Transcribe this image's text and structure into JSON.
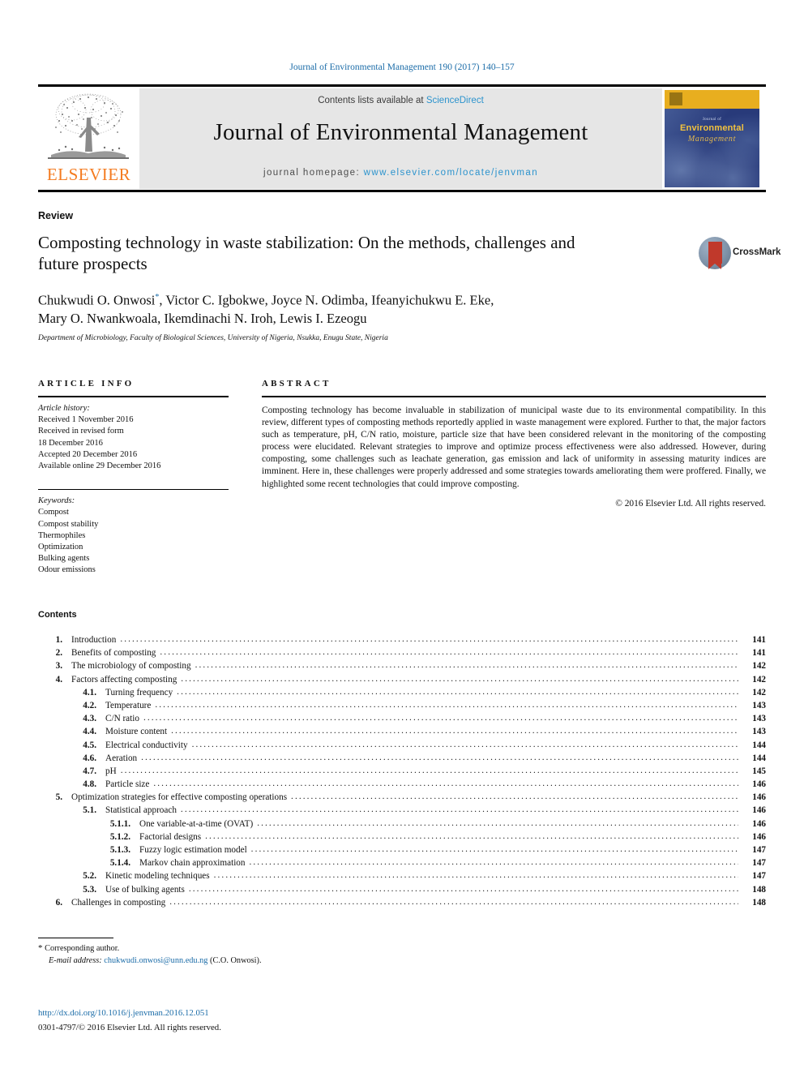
{
  "running_head": "Journal of Environmental Management 190 (2017) 140–157",
  "masthead": {
    "contents_prefix": "Contents lists available at ",
    "contents_link": "ScienceDirect",
    "journal_title": "Journal of Environmental Management",
    "homepage_prefix": "journal homepage: ",
    "homepage_url": "www.elsevier.com/locate/jenvman",
    "publisher_wordmark": "ELSEVIER",
    "cover": {
      "small_line": "Journal of",
      "line1": "Environmental",
      "line2": "Management"
    }
  },
  "article": {
    "type": "Review",
    "title": "Composting technology in waste stabilization: On the methods, challenges and future prospects",
    "authors_line1": "Chukwudi O. Onwosi",
    "authors_marker": "*",
    "authors_line1_rest": ", Victor C. Igbokwe, Joyce N. Odimba, Ifeanyichukwu E. Eke,",
    "authors_line2": "Mary O. Nwankwoala, Ikemdinachi N. Iroh, Lewis I. Ezeogu",
    "affiliation": "Department of Microbiology, Faculty of Biological Sciences, University of Nigeria, Nsukka, Enugu State, Nigeria",
    "crossmark_label": "CrossMark"
  },
  "article_info": {
    "heading": "ARTICLE INFO",
    "history_label": "Article history:",
    "history": [
      "Received 1 November 2016",
      "Received in revised form",
      "18 December 2016",
      "Accepted 20 December 2016",
      "Available online 29 December 2016"
    ],
    "keywords_label": "Keywords:",
    "keywords": [
      "Compost",
      "Compost stability",
      "Thermophiles",
      "Optimization",
      "Bulking agents",
      "Odour emissions"
    ]
  },
  "abstract": {
    "heading": "ABSTRACT",
    "text": "Composting technology has become invaluable in stabilization of municipal waste due to its environmental compatibility. In this review, different types of composting methods reportedly applied in waste management were explored. Further to that, the major factors such as temperature, pH, C/N ratio, moisture, particle size that have been considered relevant in the monitoring of the composting process were elucidated. Relevant strategies to improve and optimize process effectiveness were also addressed. However, during composting, some challenges such as leachate generation, gas emission and lack of uniformity in assessing maturity indices are imminent. Here in, these challenges were properly addressed and some strategies towards ameliorating them were proffered. Finally, we highlighted some recent technologies that could improve composting.",
    "copyright": "© 2016 Elsevier Ltd. All rights reserved."
  },
  "contents": {
    "heading": "Contents",
    "entries": [
      {
        "level": 1,
        "num": "1.",
        "label": "Introduction",
        "page": "141"
      },
      {
        "level": 1,
        "num": "2.",
        "label": "Benefits of composting",
        "page": "141"
      },
      {
        "level": 1,
        "num": "3.",
        "label": "The microbiology of composting",
        "page": "142"
      },
      {
        "level": 1,
        "num": "4.",
        "label": "Factors affecting composting",
        "page": "142"
      },
      {
        "level": 2,
        "num": "4.1.",
        "label": "Turning frequency",
        "page": "142"
      },
      {
        "level": 2,
        "num": "4.2.",
        "label": "Temperature",
        "page": "143"
      },
      {
        "level": 2,
        "num": "4.3.",
        "label": "C/N ratio",
        "page": "143"
      },
      {
        "level": 2,
        "num": "4.4.",
        "label": "Moisture content",
        "page": "143"
      },
      {
        "level": 2,
        "num": "4.5.",
        "label": "Electrical conductivity",
        "page": "144"
      },
      {
        "level": 2,
        "num": "4.6.",
        "label": "Aeration",
        "page": "144"
      },
      {
        "level": 2,
        "num": "4.7.",
        "label": "pH",
        "page": "145"
      },
      {
        "level": 2,
        "num": "4.8.",
        "label": "Particle size",
        "page": "146"
      },
      {
        "level": 1,
        "num": "5.",
        "label": "Optimization strategies for effective composting operations",
        "page": "146"
      },
      {
        "level": 2,
        "num": "5.1.",
        "label": "Statistical approach",
        "page": "146"
      },
      {
        "level": 3,
        "num": "5.1.1.",
        "label": "One variable-at-a-time (OVAT)",
        "page": "146"
      },
      {
        "level": 3,
        "num": "5.1.2.",
        "label": "Factorial designs",
        "page": "146"
      },
      {
        "level": 3,
        "num": "5.1.3.",
        "label": "Fuzzy logic estimation model",
        "page": "147"
      },
      {
        "level": 3,
        "num": "5.1.4.",
        "label": "Markov chain approximation",
        "page": "147"
      },
      {
        "level": 2,
        "num": "5.2.",
        "label": "Kinetic modeling techniques",
        "page": "147"
      },
      {
        "level": 2,
        "num": "5.3.",
        "label": "Use of bulking agents",
        "page": "148"
      },
      {
        "level": 1,
        "num": "6.",
        "label": "Challenges in composting",
        "page": "148"
      }
    ]
  },
  "footer": {
    "corresponding_author": "Corresponding author.",
    "email_label": "E-mail address:",
    "email": "chukwudi.onwosi@unn.edu.ng",
    "email_suffix": "(C.O. Onwosi).",
    "doi": "http://dx.doi.org/10.1016/j.jenvman.2016.12.051",
    "issn_copyright": "0301-4797/© 2016 Elsevier Ltd. All rights reserved."
  },
  "colors": {
    "link_blue": "#1b6ca8",
    "sciencedirect_blue": "#2b93cd",
    "elsevier_orange": "#F47B20",
    "cover_blue": "#283a7a",
    "cover_gold": "#e8ae1f",
    "panel_grey": "#e6e6e6",
    "crossmark_red": "#c0392b"
  }
}
